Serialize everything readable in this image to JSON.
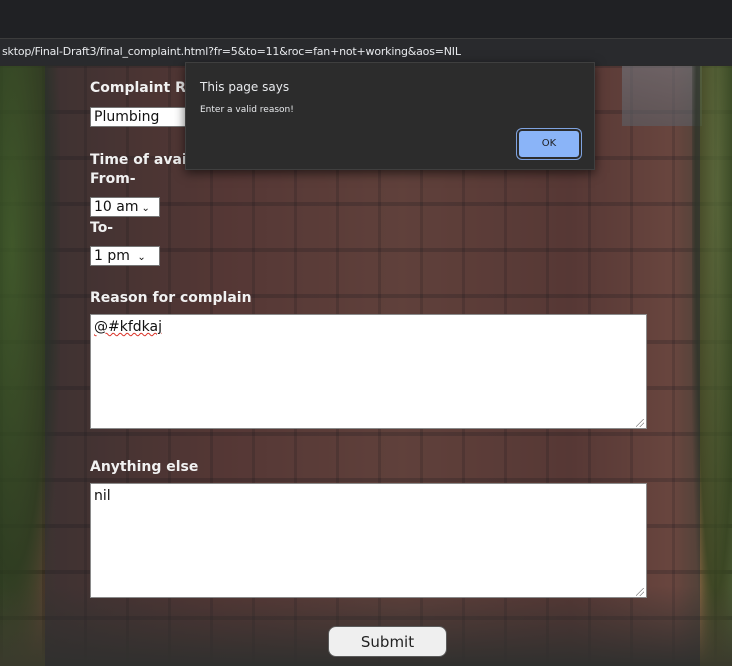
{
  "browser": {
    "url": "sktop/Final-Draft3/final_complaint.html?fr=5&to=11&roc=fan+not+working&aos=NIL"
  },
  "form": {
    "complaint_label": "Complaint Re",
    "complaint_value": "Plumbing",
    "time_label": "Time of avail",
    "from_label": "From-",
    "from_value": "10 am",
    "to_label": "To-",
    "to_value": "1 pm",
    "reason_label": "Reason for complain",
    "reason_value": "@#kfdkaj",
    "else_label": "Anything else",
    "else_value": "nil",
    "submit_label": "Submit"
  },
  "dialog": {
    "title": "This page says",
    "message": "Enter a valid reason!",
    "ok_label": "OK"
  },
  "icons": {
    "select_chevron": "chevron-down-icon",
    "textarea_grip": "resize-grip-icon"
  },
  "colors": {
    "dialog_bg": "#2c2c2c",
    "ok_button": "#8ab4f8"
  }
}
